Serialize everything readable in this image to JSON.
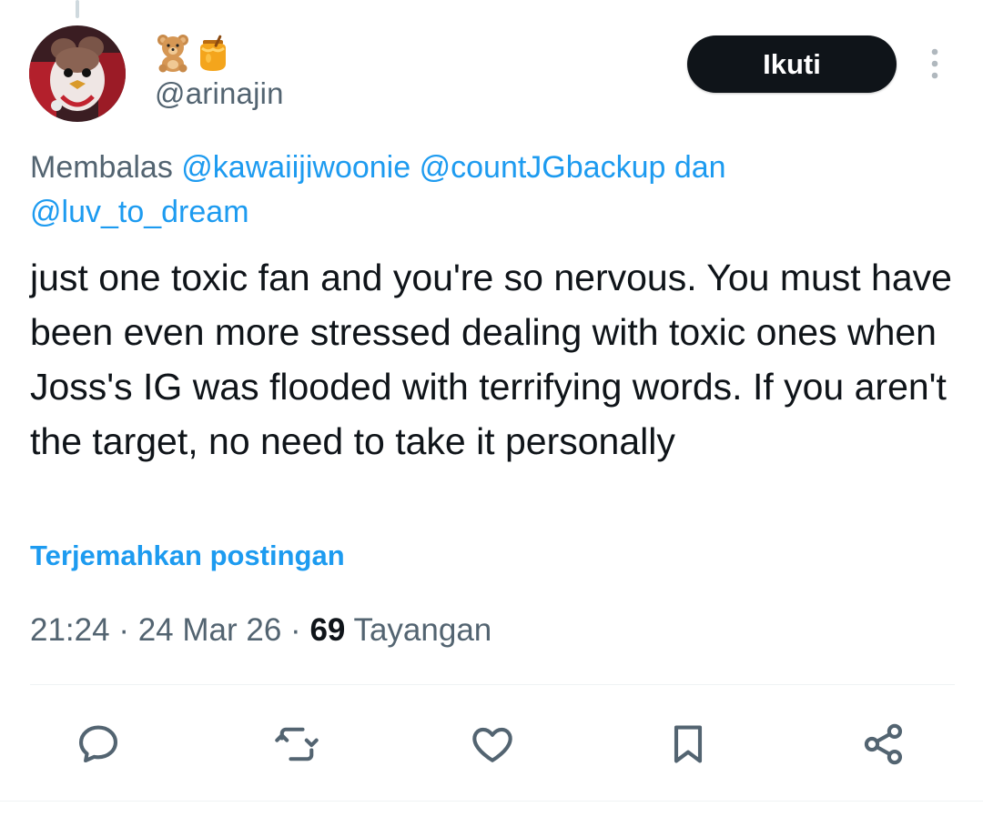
{
  "author": {
    "display_name_emojis": [
      "teddy-bear",
      "honey-pot"
    ],
    "handle": "@arinajin"
  },
  "follow_button": {
    "label": "Ikuti"
  },
  "reply_context": {
    "prefix": "Membalas",
    "mentions": [
      "@kawaiijiwoonie",
      "@countJGbackup",
      "@luv_to_dream"
    ],
    "conjunction": "dan"
  },
  "tweet": {
    "text": "just one toxic fan and you're so nervous.  You must have been even more stressed dealing with toxic ones when Joss's IG was flooded with terrifying words. If you aren't the target, no need to take it personally",
    "translate_label": "Terjemahkan postingan",
    "time": "21:24",
    "date": "24 Mar 26",
    "views_count": "69",
    "views_label": "Tayangan"
  },
  "actions": [
    {
      "name": "reply",
      "icon": "speech-bubble-icon"
    },
    {
      "name": "retweet",
      "icon": "retweet-icon"
    },
    {
      "name": "like",
      "icon": "heart-icon"
    },
    {
      "name": "bookmark",
      "icon": "bookmark-icon"
    },
    {
      "name": "share",
      "icon": "share-icon"
    }
  ],
  "colors": {
    "text_primary": "#0f1419",
    "text_secondary": "#536471",
    "link": "#1d9bf0",
    "button_bg": "#0f1419"
  }
}
